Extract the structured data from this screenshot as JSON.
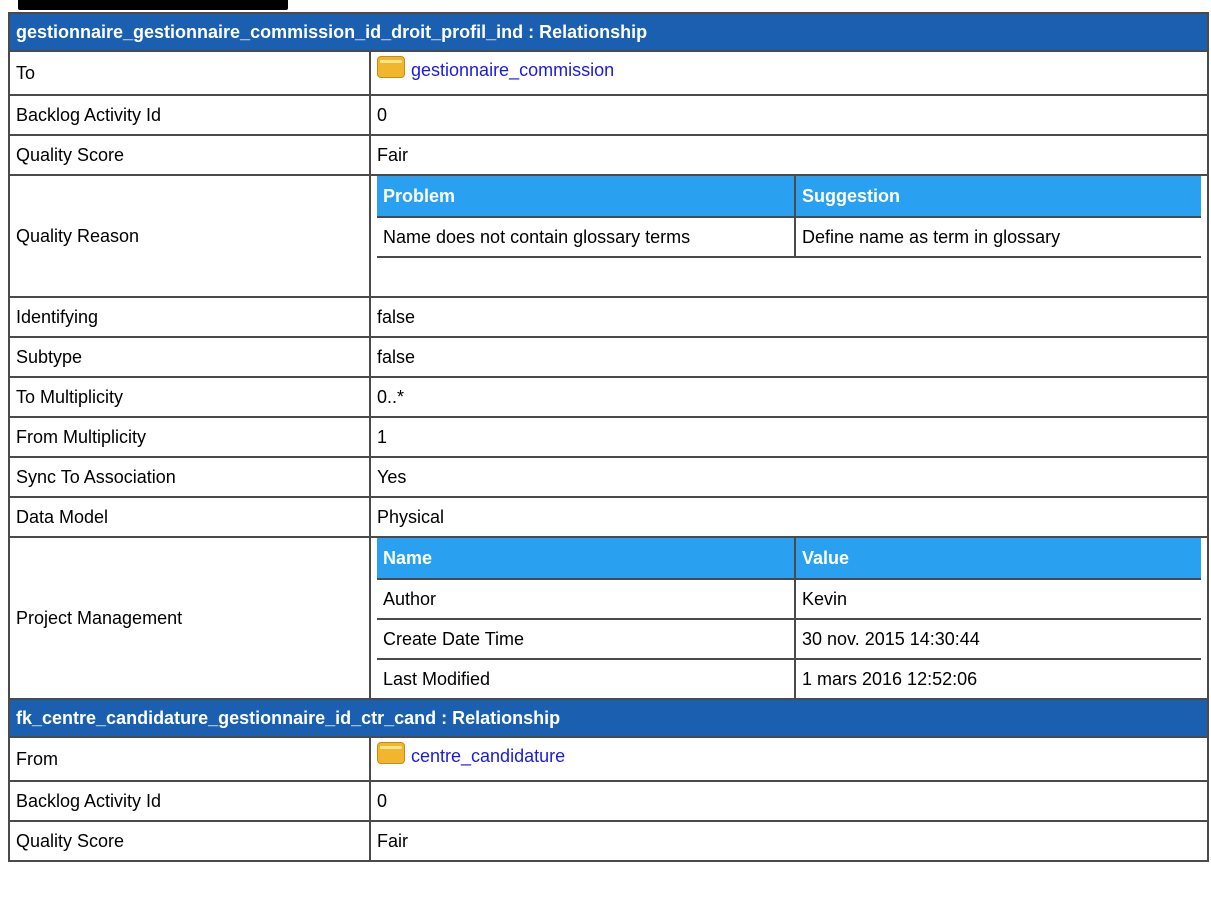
{
  "sections": [
    {
      "title": "gestionnaire_gestionnaire_commission_id_droit_profil_ind : Relationship",
      "link_row": {
        "label": "To",
        "value": "gestionnaire_commission",
        "icon": "table-folder-icon"
      },
      "rows": [
        {
          "label": "Backlog Activity Id",
          "value": "0"
        },
        {
          "label": "Quality Score",
          "value": "Fair"
        }
      ],
      "quality_reason": {
        "label": "Quality Reason",
        "headers": [
          "Problem",
          "Suggestion"
        ],
        "rows": [
          [
            "Name does not contain glossary terms",
            "Define name as term in glossary"
          ]
        ]
      },
      "rows2": [
        {
          "label": "Identifying",
          "value": "false"
        },
        {
          "label": "Subtype",
          "value": "false"
        },
        {
          "label": "To Multiplicity",
          "value": "0..*"
        },
        {
          "label": "From Multiplicity",
          "value": "1"
        },
        {
          "label": "Sync To Association",
          "value": "Yes"
        },
        {
          "label": "Data Model",
          "value": "Physical"
        }
      ],
      "project_management": {
        "label": "Project Management",
        "headers": [
          "Name",
          "Value"
        ],
        "rows": [
          [
            "Author",
            "Kevin"
          ],
          [
            "Create Date Time",
            "30 nov. 2015 14:30:44"
          ],
          [
            "Last Modified",
            "1 mars 2016 12:52:06"
          ]
        ]
      }
    },
    {
      "title": "fk_centre_candidature_gestionnaire_id_ctr_cand : Relationship",
      "link_row": {
        "label": "From",
        "value": "centre_candidature",
        "icon": "table-folder-icon"
      },
      "rows": [
        {
          "label": "Backlog Activity Id",
          "value": "0"
        },
        {
          "label": "Quality Score",
          "value": "Fair"
        }
      ]
    }
  ],
  "colors": {
    "section_header": "#1a5fb0",
    "inner_header": "#2aa0f0",
    "link": "#1a1ae6",
    "border": "#4a4a4a"
  }
}
